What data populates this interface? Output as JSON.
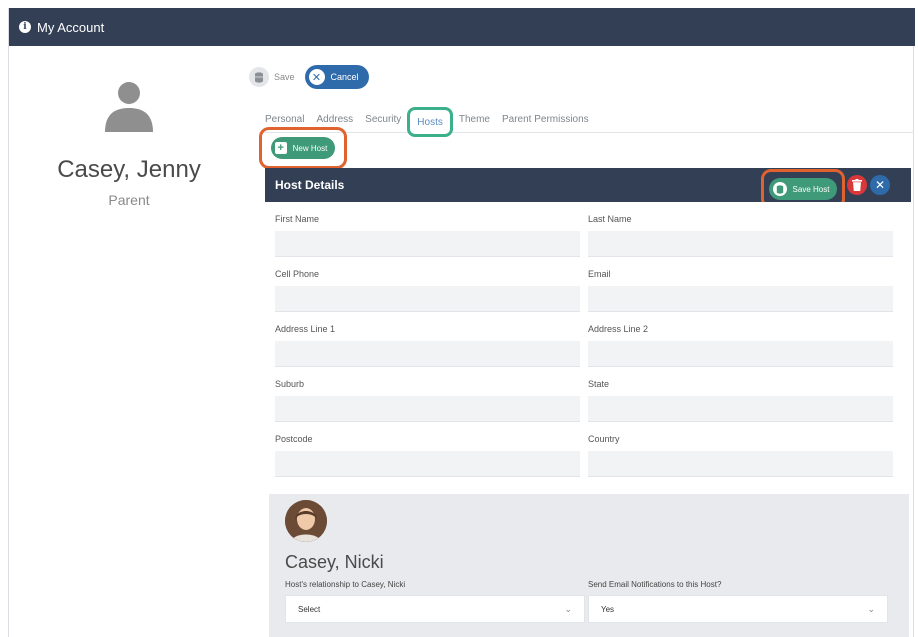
{
  "window": {
    "title": "My Account"
  },
  "profile": {
    "name": "Casey, Jenny",
    "role": "Parent"
  },
  "toolbar": {
    "save_label": "Save",
    "cancel_label": "Cancel"
  },
  "tabs": [
    {
      "label": "Personal",
      "active": false
    },
    {
      "label": "Address",
      "active": false
    },
    {
      "label": "Security",
      "active": false
    },
    {
      "label": "Hosts",
      "active": true
    },
    {
      "label": "Theme",
      "active": false
    },
    {
      "label": "Parent Permissions",
      "active": false
    }
  ],
  "hosts": {
    "new_host_label": "New Host"
  },
  "panel": {
    "title": "Host Details",
    "save_host_label": "Save Host",
    "fields": {
      "first_name": {
        "label": "First Name",
        "value": ""
      },
      "last_name": {
        "label": "Last Name",
        "value": ""
      },
      "cell_phone": {
        "label": "Cell Phone",
        "value": ""
      },
      "email": {
        "label": "Email",
        "value": ""
      },
      "address_line_1": {
        "label": "Address Line 1",
        "value": ""
      },
      "address_line_2": {
        "label": "Address Line 2",
        "value": ""
      },
      "suburb": {
        "label": "Suburb",
        "value": ""
      },
      "state": {
        "label": "State",
        "value": ""
      },
      "postcode": {
        "label": "Postcode",
        "value": ""
      },
      "country": {
        "label": "Country",
        "value": ""
      }
    }
  },
  "host_card": {
    "name": "Casey, Nicki",
    "relationship_label": "Host's relationship to Casey, Nicki",
    "relationship_value": "Select",
    "notify_label": "Send Email Notifications to this Host?",
    "notify_value": "Yes"
  },
  "colors": {
    "header_bg": "#323f55",
    "primary_blue": "#2f6bab",
    "green": "#3e9a78",
    "highlight_orange": "#e0622f",
    "highlight_teal": "#3cb08b",
    "danger": "#d9383a"
  },
  "icons": {
    "window": "info-icon",
    "avatar": "user-silhouette-icon",
    "save": "database-icon",
    "cancel": "close-icon",
    "new_host": "plus-square-icon",
    "save_host": "database-icon",
    "delete": "trash-icon",
    "close": "close-icon",
    "dropdown": "chevron-down-icon"
  }
}
